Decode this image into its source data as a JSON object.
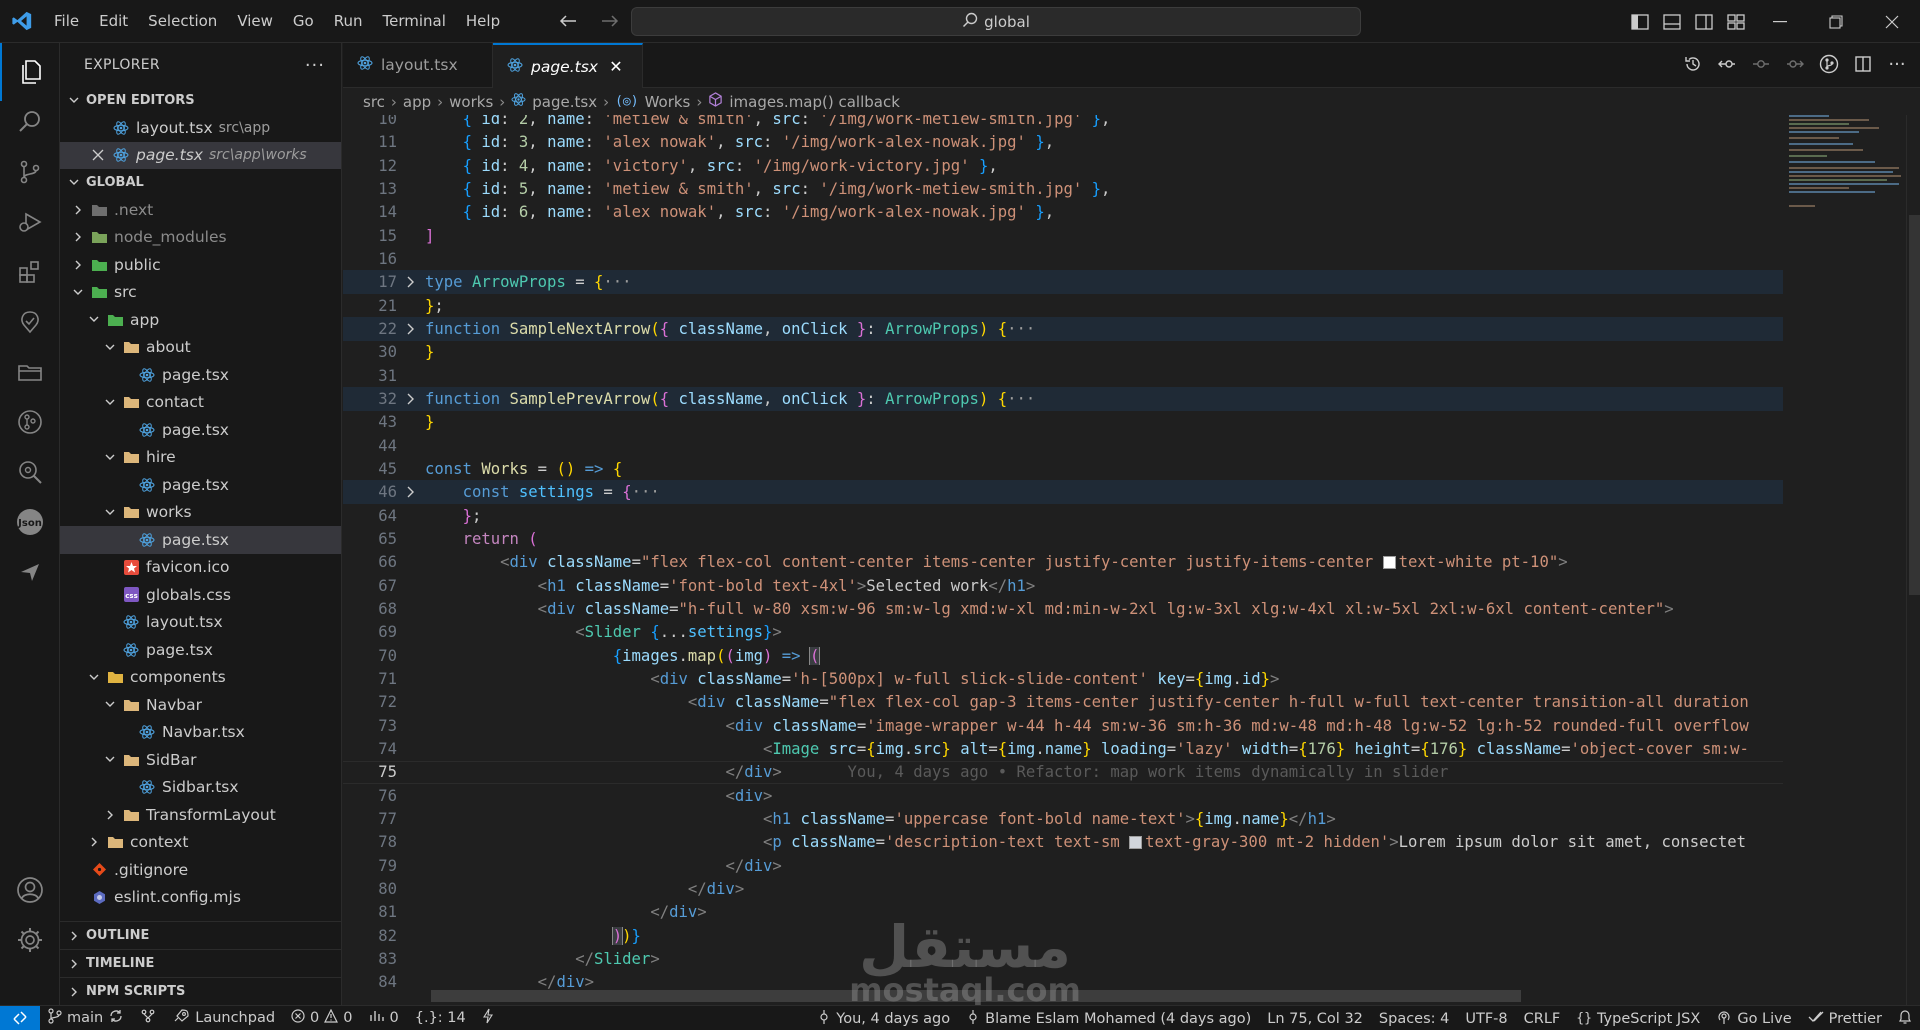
{
  "titlebar": {
    "menu": [
      "File",
      "Edit",
      "Selection",
      "View",
      "Go",
      "Run",
      "Terminal",
      "Help"
    ],
    "search_text": "global"
  },
  "sidebar": {
    "title": "EXPLORER",
    "open_editors_label": "OPEN EDITORS",
    "open_editors": [
      {
        "name": "layout.tsx",
        "path": "src\\app"
      },
      {
        "name": "page.tsx",
        "path": "src\\app\\works"
      }
    ],
    "workspace_label": "GLOBAL",
    "tree": [
      {
        "name": ".next",
        "type": "folder"
      },
      {
        "name": "node_modules",
        "type": "folder"
      },
      {
        "name": "public",
        "type": "folder"
      },
      {
        "name": "src",
        "type": "folder"
      },
      {
        "name": "app",
        "type": "folder"
      },
      {
        "name": "about",
        "type": "folder"
      },
      {
        "name": "page.tsx",
        "type": "file"
      },
      {
        "name": "contact",
        "type": "folder"
      },
      {
        "name": "page.tsx",
        "type": "file"
      },
      {
        "name": "hire",
        "type": "folder"
      },
      {
        "name": "page.tsx",
        "type": "file"
      },
      {
        "name": "works",
        "type": "folder"
      },
      {
        "name": "page.tsx",
        "type": "file"
      },
      {
        "name": "favicon.ico",
        "type": "file"
      },
      {
        "name": "globals.css",
        "type": "file"
      },
      {
        "name": "layout.tsx",
        "type": "file"
      },
      {
        "name": "page.tsx",
        "type": "file"
      },
      {
        "name": "components",
        "type": "folder"
      },
      {
        "name": "Navbar",
        "type": "folder"
      },
      {
        "name": "Navbar.tsx",
        "type": "file"
      },
      {
        "name": "SidBar",
        "type": "folder"
      },
      {
        "name": "Sidbar.tsx",
        "type": "file"
      },
      {
        "name": "TransformLayout",
        "type": "folder"
      },
      {
        "name": "context",
        "type": "folder"
      },
      {
        "name": ".gitignore",
        "type": "file"
      },
      {
        "name": "eslint.config.mjs",
        "type": "file"
      }
    ],
    "bottom_sections": [
      "OUTLINE",
      "TIMELINE",
      "NPM SCRIPTS"
    ]
  },
  "tabs": [
    {
      "label": "layout.tsx",
      "active": false
    },
    {
      "label": "page.tsx",
      "active": true
    }
  ],
  "breadcrumb": [
    "src",
    "app",
    "works",
    "page.tsx",
    "Works",
    "images.map() callback"
  ],
  "editor": {
    "line_numbers": [
      "10",
      "11",
      "12",
      "13",
      "14",
      "15",
      "16",
      "17",
      "21",
      "22",
      "30",
      "31",
      "32",
      "43",
      "44",
      "45",
      "46",
      "64",
      "65",
      "66",
      "67",
      "68",
      "69",
      "70",
      "71",
      "72",
      "73",
      "74",
      "75",
      "76",
      "77",
      "78",
      "79",
      "80",
      "81",
      "82",
      "83",
      "84"
    ],
    "current_line": "75",
    "blame": "You, 4 days ago • Refactor: map work items dynamically in slider",
    "fold_ellipsis": "···"
  },
  "watermark": {
    "arabic": "مستقل",
    "latin": "mostaql.com"
  },
  "statusbar": {
    "branch": "main",
    "launchpad": "Launchpad",
    "errors": "0",
    "warnings": "0",
    "ports": "0",
    "selection": "{.}: 14",
    "blame_short": "You, 4 days ago",
    "blame_full": "Blame Eslam Mohamed (4 days ago)",
    "position": "Ln 75, Col 32",
    "spaces": "Spaces: 4",
    "encoding": "UTF-8",
    "eol": "CRLF",
    "language": "TypeScript JSX",
    "golive": "Go Live",
    "prettier": "Prettier"
  },
  "colors": {
    "accent": "#0078d4",
    "background": "#1f1f1f",
    "chrome": "#181818"
  }
}
